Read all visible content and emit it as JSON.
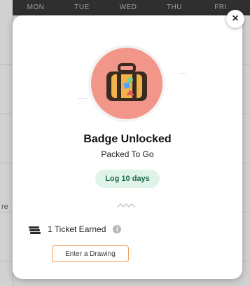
{
  "background": {
    "weekdays": [
      "MON",
      "TUE",
      "WED",
      "THU",
      "FRI"
    ],
    "edge_text": "re"
  },
  "modal": {
    "close_symbol": "×",
    "badge": {
      "icon": "suitcase-icon",
      "circle_color": "#f2968a",
      "title": "Badge Unlocked",
      "subtitle": "Packed To Go"
    },
    "requirement_pill": "Log 10 days",
    "reward": {
      "icon": "ticket-icon",
      "text": "1 Ticket Earned",
      "info_icon": "info-icon",
      "info_symbol": "i"
    },
    "cta_button": "Enter a Drawing",
    "colors": {
      "pill_bg": "#dff3e9",
      "pill_text": "#1f6b49",
      "cta_border": "#f0a060"
    }
  }
}
